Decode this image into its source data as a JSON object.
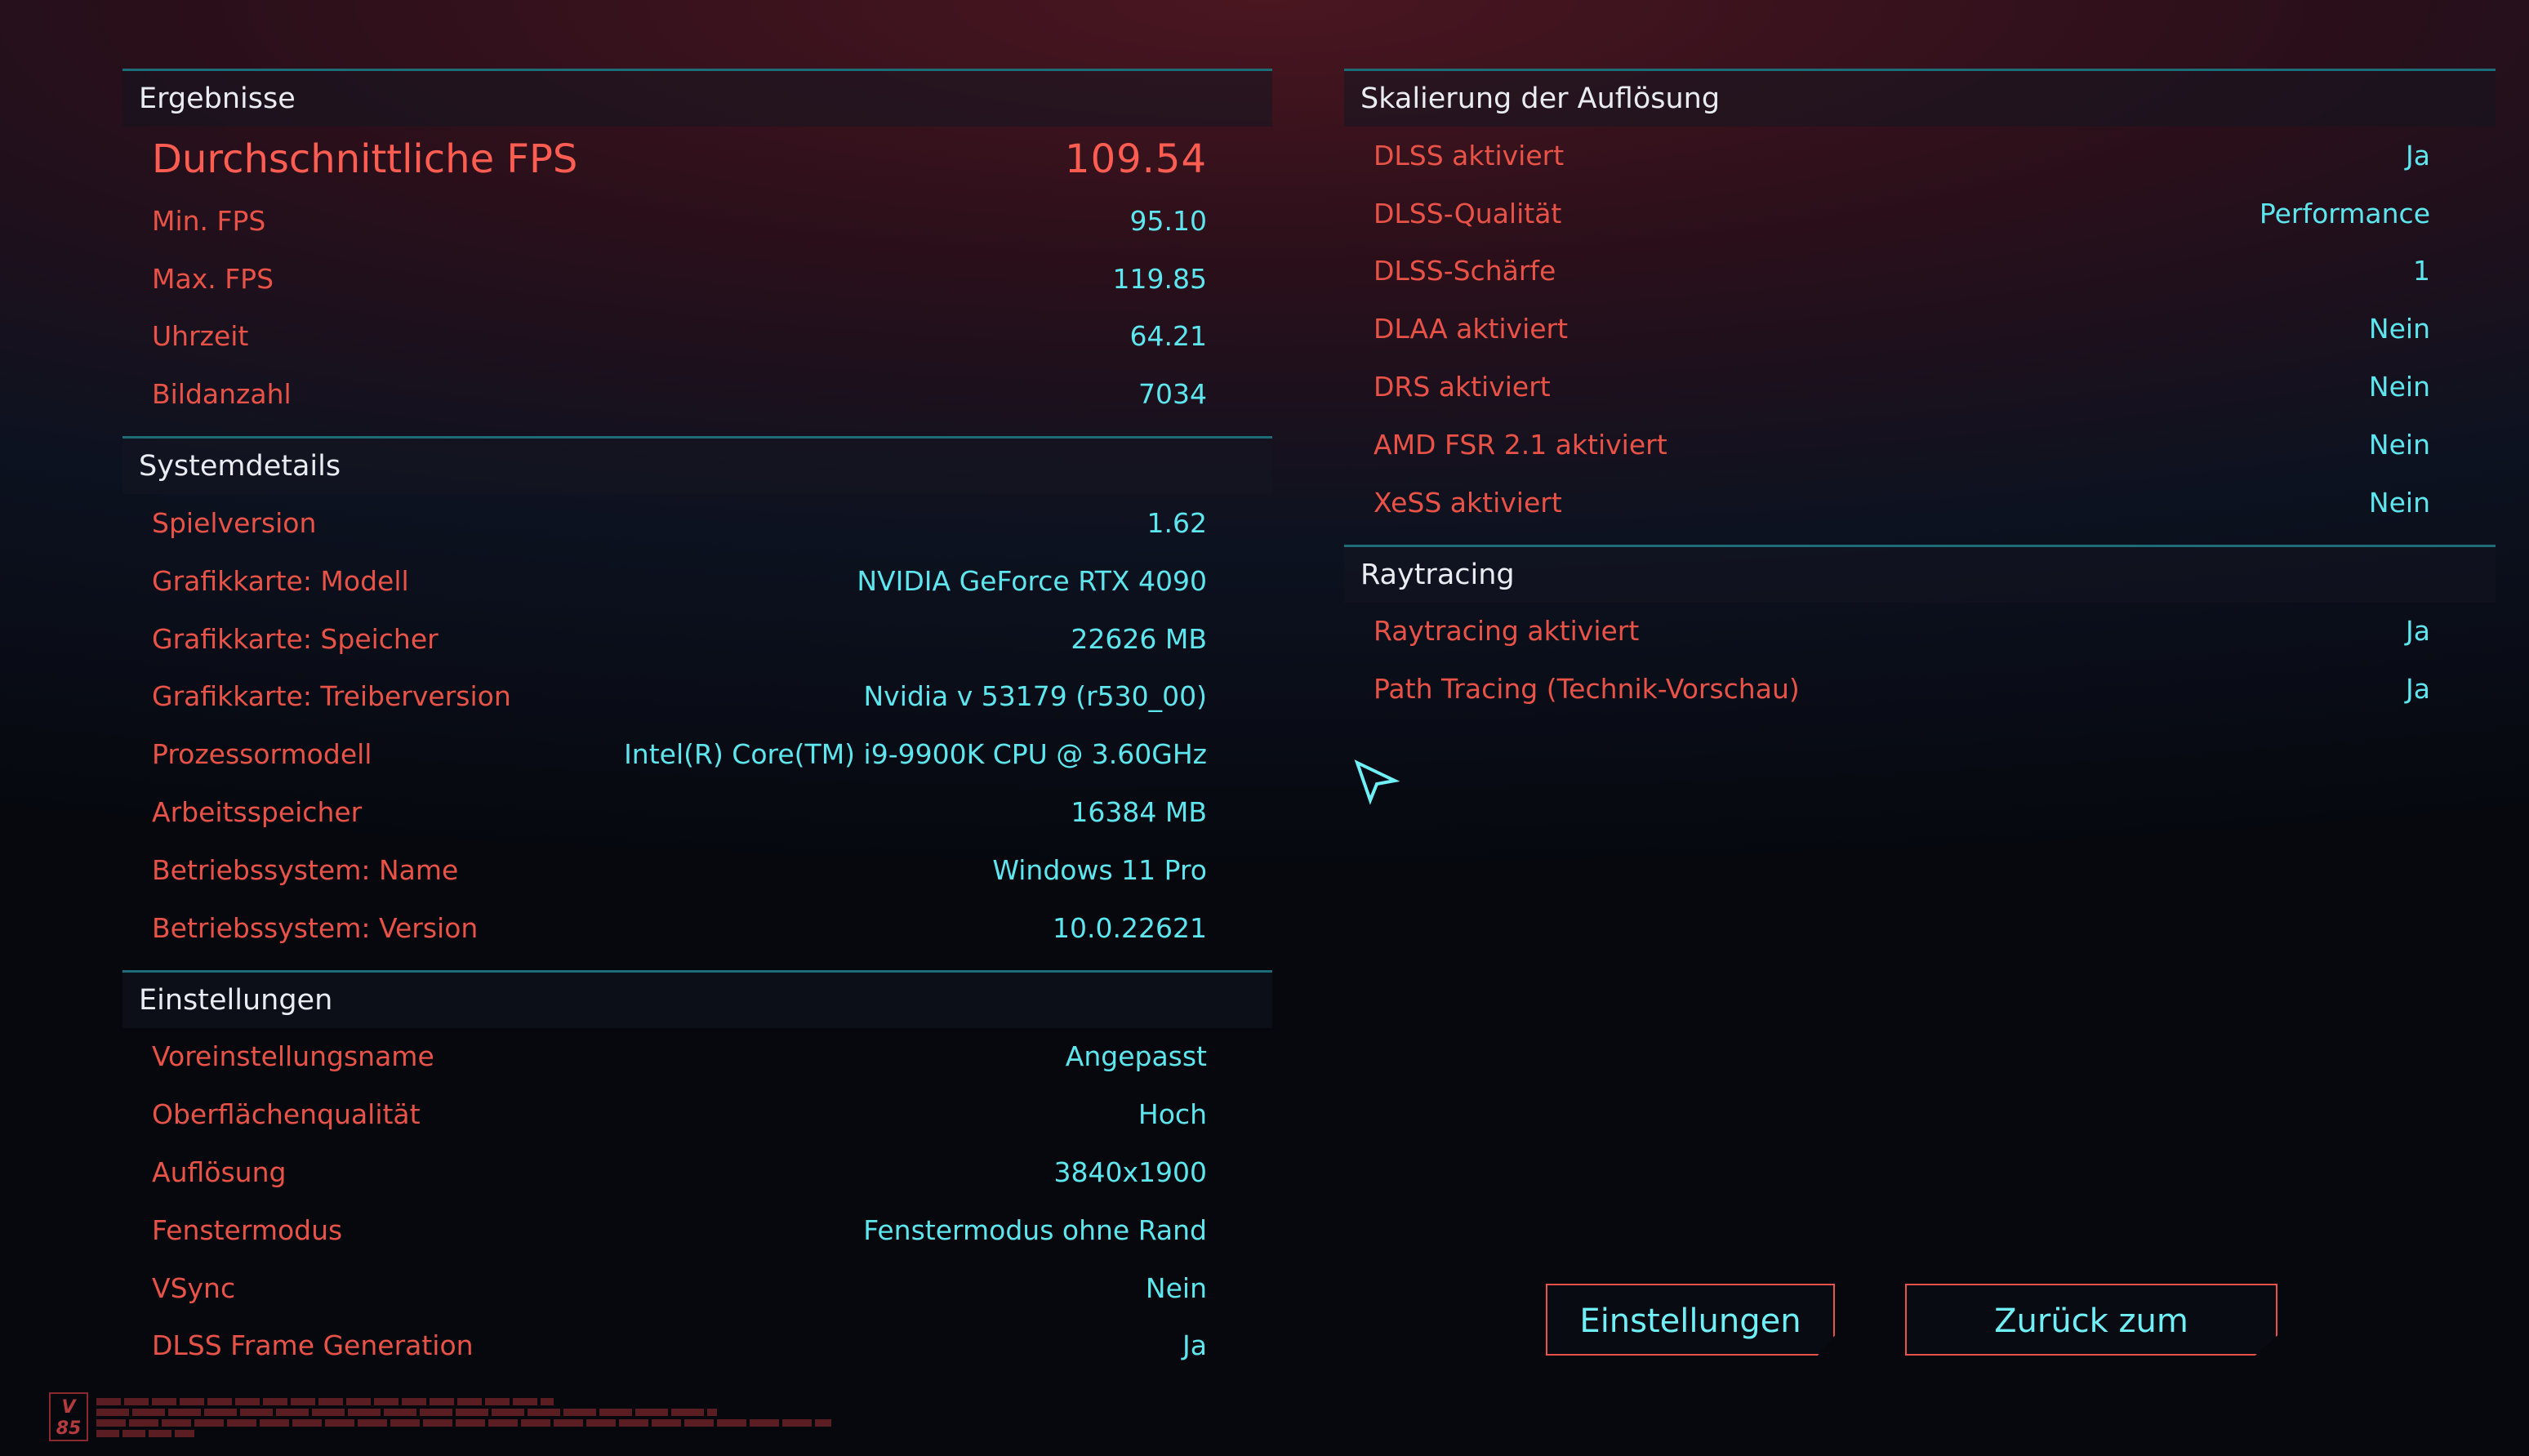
{
  "results": {
    "header": "Ergebnisse",
    "avg_fps": {
      "label": "Durchschnittliche FPS",
      "value": "109.54"
    },
    "rows": [
      {
        "label": "Min. FPS",
        "value": "95.10"
      },
      {
        "label": "Max. FPS",
        "value": "119.85"
      },
      {
        "label": "Uhrzeit",
        "value": "64.21"
      },
      {
        "label": "Bildanzahl",
        "value": "7034"
      }
    ]
  },
  "system": {
    "header": "Systemdetails",
    "rows": [
      {
        "label": "Spielversion",
        "value": "1.62"
      },
      {
        "label": "Grafikkarte: Modell",
        "value": "NVIDIA GeForce RTX 4090"
      },
      {
        "label": "Grafikkarte: Speicher",
        "value": "22626 MB"
      },
      {
        "label": "Grafikkarte: Treiberversion",
        "value": "Nvidia v 53179 (r530_00)"
      },
      {
        "label": "Prozessormodell",
        "value": "Intel(R) Core(TM) i9-9900K CPU @ 3.60GHz"
      },
      {
        "label": "Arbeitsspeicher",
        "value": "16384 MB"
      },
      {
        "label": "Betriebssystem: Name",
        "value": "Windows 11 Pro"
      },
      {
        "label": "Betriebssystem: Version",
        "value": "10.0.22621"
      }
    ]
  },
  "settings": {
    "header": "Einstellungen",
    "rows": [
      {
        "label": "Voreinstellungsname",
        "value": "Angepasst"
      },
      {
        "label": "Oberflächenqualität",
        "value": "Hoch"
      },
      {
        "label": "Auflösung",
        "value": "3840x1900"
      },
      {
        "label": "Fenstermodus",
        "value": "Fenstermodus ohne Rand"
      },
      {
        "label": "VSync",
        "value": "Nein"
      },
      {
        "label": "DLSS Frame Generation",
        "value": "Ja"
      }
    ]
  },
  "scaling": {
    "header": "Skalierung der Auflösung",
    "rows": [
      {
        "label": "DLSS aktiviert",
        "value": "Ja"
      },
      {
        "label": "DLSS-Qualität",
        "value": "Performance"
      },
      {
        "label": "DLSS-Schärfe",
        "value": "1"
      },
      {
        "label": "DLAA aktiviert",
        "value": "Nein"
      },
      {
        "label": "DRS aktiviert",
        "value": "Nein"
      },
      {
        "label": "AMD FSR 2.1 aktiviert",
        "value": "Nein"
      },
      {
        "label": "XeSS aktiviert",
        "value": "Nein"
      }
    ]
  },
  "raytracing": {
    "header": "Raytracing",
    "rows": [
      {
        "label": "Raytracing aktiviert",
        "value": "Ja"
      },
      {
        "label": "Path Tracing (Technik-Vorschau)",
        "value": "Ja"
      }
    ]
  },
  "buttons": {
    "settings": "Einstellungen",
    "back": "Zurück zum Hauptmenü"
  },
  "badge": {
    "line1": "V",
    "line2": "85"
  },
  "colors": {
    "label": "#e85247",
    "value": "#5ee6ee",
    "header_line": "#1c6d78",
    "button_border": "#e8524a"
  }
}
